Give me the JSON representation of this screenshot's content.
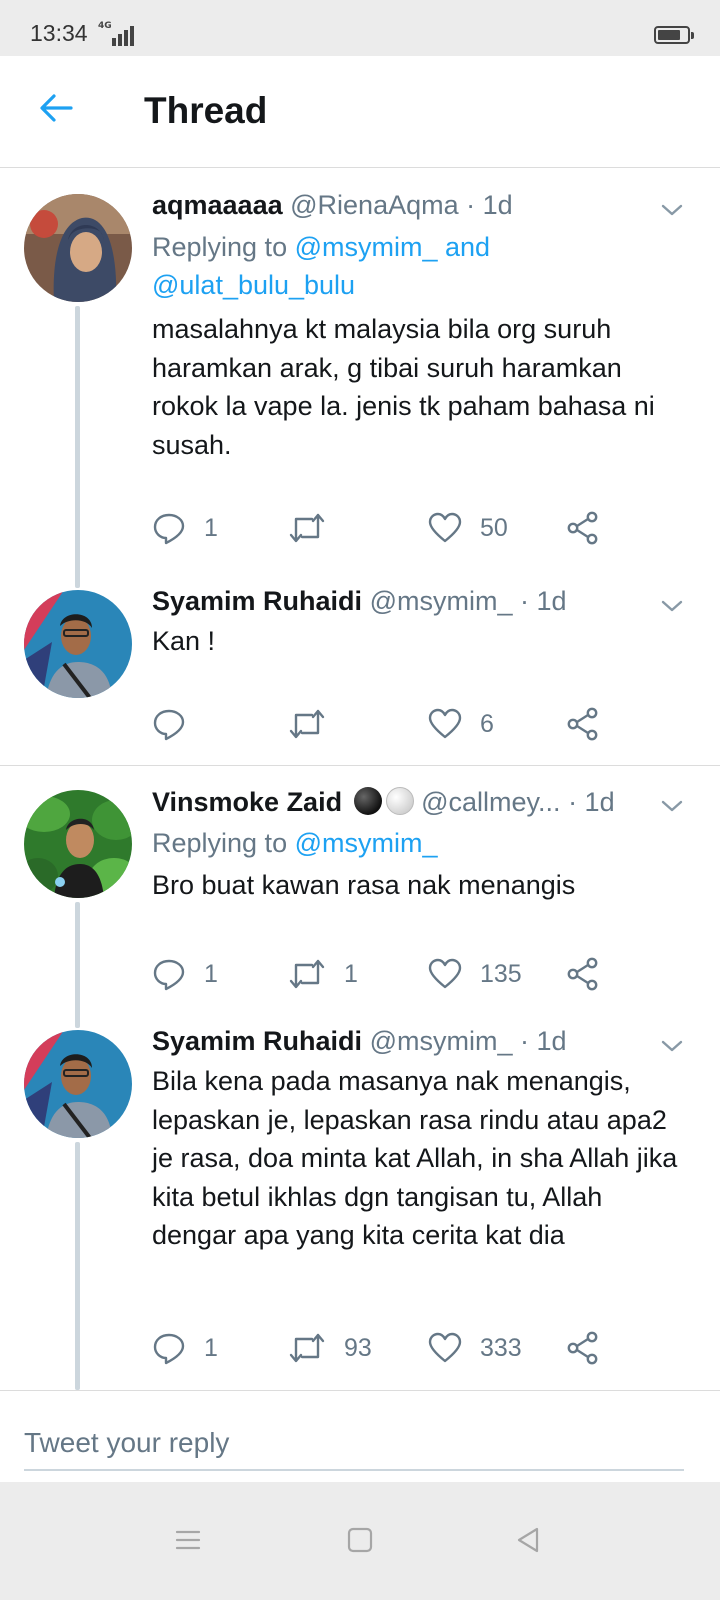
{
  "status_bar": {
    "time": "13:34",
    "network": "4G",
    "signal_level": 1.0,
    "battery_level": 0.8
  },
  "header": {
    "title": "Thread",
    "back_icon": "arrow-left-icon",
    "accent": "#1da1f2"
  },
  "tweets": [
    {
      "name": "aqmaaaaa",
      "handle": "@RienaAqma",
      "time": "· 1d",
      "reply_prefix": "Replying to ",
      "reply_mentions": "@msymim_ and",
      "reply_mentions_2": "@ulat_bulu_bulu",
      "text": "masalahnya kt malaysia bila org suruh haramkan arak, g tibai suruh haramkan rokok la vape la. jenis tk paham bahasa ni susah.",
      "replies": "1",
      "retweets": "",
      "likes": "50"
    },
    {
      "name": "Syamim Ruhaidi",
      "handle": "@msymim_",
      "time": "· 1d",
      "text": "Kan !",
      "replies": "",
      "retweets": "",
      "likes": "6"
    },
    {
      "name": "Vinsmoke Zaid",
      "handle": "@callmey...",
      "time": "· 1d",
      "reply_prefix": "Replying to ",
      "reply_mentions": "@msymim_",
      "text": "Bro buat kawan rasa nak menangis",
      "replies": "1",
      "retweets": "1",
      "likes": "135"
    },
    {
      "name": "Syamim Ruhaidi",
      "handle": "@msymim_",
      "time": "· 1d",
      "text": "Bila kena pada masanya nak menangis, lepaskan je, lepaskan rasa rindu atau apa2 je rasa, doa minta kat Allah, in sha Allah jika kita betul ikhlas dgn tangisan tu, Allah dengar apa yang kita cerita kat dia",
      "replies": "1",
      "retweets": "93",
      "likes": "333"
    }
  ],
  "reply_box": {
    "placeholder": "Tweet your reply"
  },
  "nav_bar": {
    "icons": [
      "menu-icon",
      "home-square-icon",
      "back-triangle-icon"
    ]
  }
}
